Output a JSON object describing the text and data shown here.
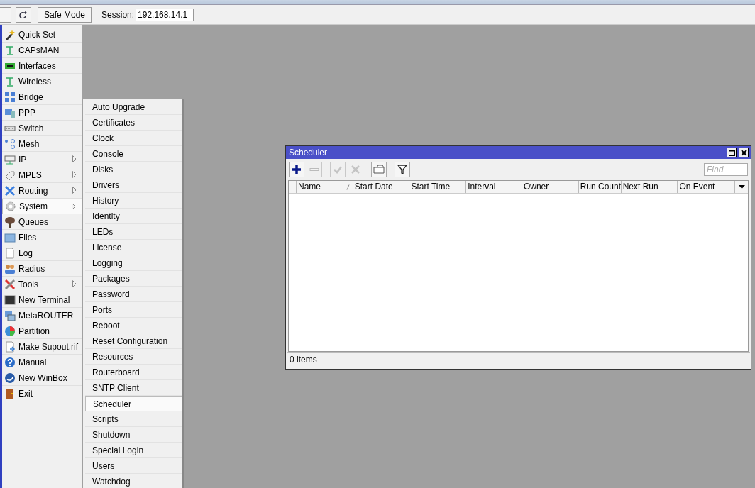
{
  "toolbar": {
    "safe_mode": {
      "label": "Safe Mode",
      "on": false
    },
    "session": {
      "label": "Session:",
      "value": "192.168.14.1"
    }
  },
  "menu": [
    {
      "label": "Quick Set",
      "submenu": false,
      "selected": false
    },
    {
      "label": "CAPsMAN",
      "submenu": false,
      "selected": false
    },
    {
      "label": "Interfaces",
      "submenu": false,
      "selected": false
    },
    {
      "label": "Wireless",
      "submenu": false,
      "selected": false
    },
    {
      "label": "Bridge",
      "submenu": false,
      "selected": false
    },
    {
      "label": "PPP",
      "submenu": false,
      "selected": false
    },
    {
      "label": "Switch",
      "submenu": false,
      "selected": false
    },
    {
      "label": "Mesh",
      "submenu": false,
      "selected": false
    },
    {
      "label": "IP",
      "submenu": true,
      "selected": false
    },
    {
      "label": "MPLS",
      "submenu": true,
      "selected": false
    },
    {
      "label": "Routing",
      "submenu": true,
      "selected": false
    },
    {
      "label": "System",
      "submenu": true,
      "selected": true
    },
    {
      "label": "Queues",
      "submenu": false,
      "selected": false
    },
    {
      "label": "Files",
      "submenu": false,
      "selected": false
    },
    {
      "label": "Log",
      "submenu": false,
      "selected": false
    },
    {
      "label": "Radius",
      "submenu": false,
      "selected": false
    },
    {
      "label": "Tools",
      "submenu": true,
      "selected": false
    },
    {
      "label": "New Terminal",
      "submenu": false,
      "selected": false
    },
    {
      "label": "MetaROUTER",
      "submenu": false,
      "selected": false
    },
    {
      "label": "Partition",
      "submenu": false,
      "selected": false
    },
    {
      "label": "Make Supout.rif",
      "submenu": false,
      "selected": false
    },
    {
      "label": "Manual",
      "submenu": false,
      "selected": false
    },
    {
      "label": "New WinBox",
      "submenu": false,
      "selected": false
    },
    {
      "label": "Exit",
      "submenu": false,
      "selected": false
    }
  ],
  "submenu": [
    {
      "label": "Auto Upgrade",
      "selected": false
    },
    {
      "label": "Certificates",
      "selected": false
    },
    {
      "label": "Clock",
      "selected": false
    },
    {
      "label": "Console",
      "selected": false
    },
    {
      "label": "Disks",
      "selected": false
    },
    {
      "label": "Drivers",
      "selected": false
    },
    {
      "label": "History",
      "selected": false
    },
    {
      "label": "Identity",
      "selected": false
    },
    {
      "label": "LEDs",
      "selected": false
    },
    {
      "label": "License",
      "selected": false
    },
    {
      "label": "Logging",
      "selected": false
    },
    {
      "label": "Packages",
      "selected": false
    },
    {
      "label": "Password",
      "selected": false
    },
    {
      "label": "Ports",
      "selected": false
    },
    {
      "label": "Reboot",
      "selected": false
    },
    {
      "label": "Reset Configuration",
      "selected": false
    },
    {
      "label": "Resources",
      "selected": false
    },
    {
      "label": "Routerboard",
      "selected": false
    },
    {
      "label": "SNTP Client",
      "selected": false
    },
    {
      "label": "Scheduler",
      "selected": true
    },
    {
      "label": "Scripts",
      "selected": false
    },
    {
      "label": "Shutdown",
      "selected": false
    },
    {
      "label": "Special Login",
      "selected": false
    },
    {
      "label": "Users",
      "selected": false
    },
    {
      "label": "Watchdog",
      "selected": false
    }
  ],
  "window": {
    "title": "Scheduler",
    "buttons": [
      {
        "kind": "add",
        "disabled": false
      },
      {
        "kind": "remove",
        "disabled": true
      },
      {
        "kind": "enable",
        "disabled": true
      },
      {
        "kind": "disable",
        "disabled": true
      },
      {
        "kind": "comment",
        "disabled": false
      },
      {
        "kind": "filter",
        "disabled": false
      }
    ],
    "find": {
      "placeholder": "Find"
    },
    "columns": [
      {
        "label": "Name",
        "sorted": true
      },
      {
        "label": "Start Date",
        "sorted": false
      },
      {
        "label": "Start Time",
        "sorted": false
      },
      {
        "label": "Interval",
        "sorted": false
      },
      {
        "label": "Owner",
        "sorted": false
      },
      {
        "label": "Run Count",
        "sorted": false
      },
      {
        "label": "Next Run",
        "sorted": false
      },
      {
        "label": "On Event",
        "sorted": false
      }
    ],
    "status": "0 items"
  }
}
